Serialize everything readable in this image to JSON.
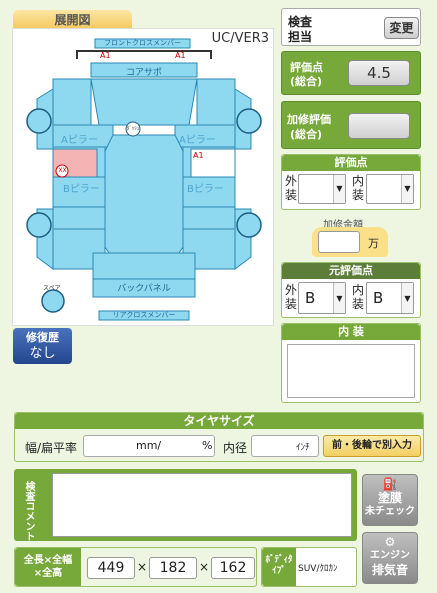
{
  "diagram": {
    "tab_label": "展開図",
    "model": "UC/VER3",
    "parts": {
      "front_cross": "フロントクロスメンバー",
      "core_support": "コアサポ",
      "a_pillar_left": "Aピラー",
      "a_pillar_right": "Aピラー",
      "b_pillar_left": "Bピラー",
      "b_pillar_right": "Bピラー",
      "back_panel": "バックパネル",
      "rear_cross": "リアクロスメンバー",
      "spare": "スペア",
      "dash": "ﾀﾞｯｼｭ"
    },
    "marks": {
      "a1_left": "A1",
      "a1_right": "A1",
      "a1_side": "A1",
      "xx": "XX"
    }
  },
  "repair_history": {
    "title": "修復歴",
    "value": "なし"
  },
  "inspector": {
    "label1": "検査",
    "label2": "担当",
    "change_button": "変更"
  },
  "overall_score": {
    "label1": "評価点",
    "label2": "(総合)",
    "value": "4.5"
  },
  "extra_score": {
    "label1": "加修評価",
    "label2": "(総合)",
    "value": ""
  },
  "score_points": {
    "title": "評価点",
    "outer_label1": "外",
    "outer_label2": "装",
    "outer_value": "",
    "inner_label1": "内",
    "inner_label2": "装",
    "inner_value": ""
  },
  "repair_cost": {
    "title": "加修金額",
    "value": "",
    "unit": "万"
  },
  "original_score": {
    "title": "元評価点",
    "outer_label1": "外",
    "outer_label2": "装",
    "outer_value": "B",
    "inner_label1": "内",
    "inner_label2": "装",
    "inner_value": "B"
  },
  "interior": {
    "title": "内 装",
    "value": ""
  },
  "tire": {
    "title": "タイヤサイズ",
    "width_label": "幅/扁平率",
    "width_value": "",
    "mm_unit": "mm/",
    "pct_unit": "%",
    "inner_label": "内径",
    "inner_value": "",
    "inch_unit": "ｲﾝﾁ",
    "split_button": "前・後輪で別入力"
  },
  "comment": {
    "label": "検査コメント",
    "value": ""
  },
  "paint_button": {
    "line1": "塗膜",
    "line2": "未チェック"
  },
  "engine_button": {
    "line1": "エンジン",
    "line2": "排気音"
  },
  "dimensions": {
    "label1": "全長×全幅",
    "label2": "×全高",
    "length": "449",
    "width": "182",
    "height": "162",
    "sep": "×"
  },
  "body_type": {
    "label1": "ﾎﾞﾃﾞｨﾀ",
    "label2": "ｲﾌﾟ",
    "value": "SUV/ｸﾛｶﾝ"
  },
  "colors": {
    "accent_green": "#76a83a",
    "body_blue": "#8ed8f0",
    "damage_pink": "#f4b4b4"
  }
}
